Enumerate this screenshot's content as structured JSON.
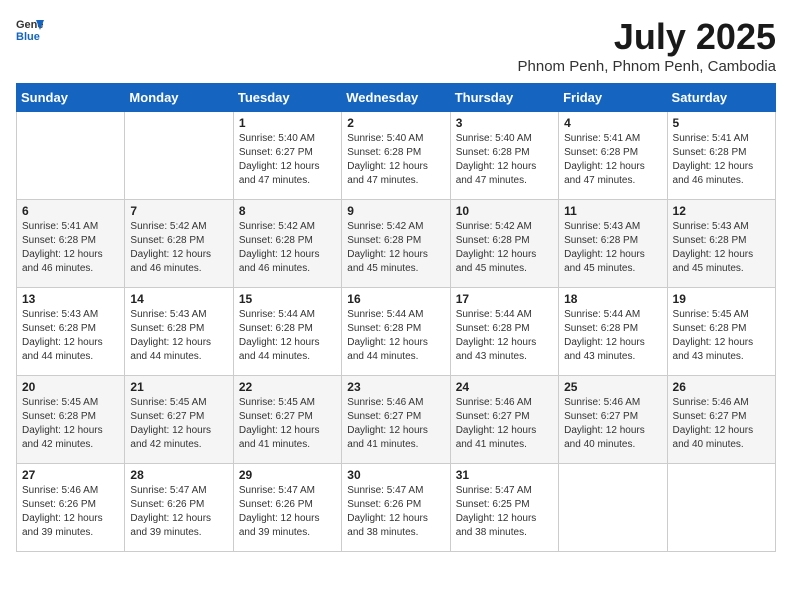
{
  "header": {
    "logo": {
      "line1": "General",
      "line2": "Blue"
    },
    "title": "July 2025",
    "subtitle": "Phnom Penh, Phnom Penh, Cambodia"
  },
  "days_of_week": [
    "Sunday",
    "Monday",
    "Tuesday",
    "Wednesday",
    "Thursday",
    "Friday",
    "Saturday"
  ],
  "weeks": [
    [
      {
        "day": "",
        "info": ""
      },
      {
        "day": "",
        "info": ""
      },
      {
        "day": "1",
        "info": "Sunrise: 5:40 AM\nSunset: 6:27 PM\nDaylight: 12 hours and 47 minutes."
      },
      {
        "day": "2",
        "info": "Sunrise: 5:40 AM\nSunset: 6:28 PM\nDaylight: 12 hours and 47 minutes."
      },
      {
        "day": "3",
        "info": "Sunrise: 5:40 AM\nSunset: 6:28 PM\nDaylight: 12 hours and 47 minutes."
      },
      {
        "day": "4",
        "info": "Sunrise: 5:41 AM\nSunset: 6:28 PM\nDaylight: 12 hours and 47 minutes."
      },
      {
        "day": "5",
        "info": "Sunrise: 5:41 AM\nSunset: 6:28 PM\nDaylight: 12 hours and 46 minutes."
      }
    ],
    [
      {
        "day": "6",
        "info": "Sunrise: 5:41 AM\nSunset: 6:28 PM\nDaylight: 12 hours and 46 minutes."
      },
      {
        "day": "7",
        "info": "Sunrise: 5:42 AM\nSunset: 6:28 PM\nDaylight: 12 hours and 46 minutes."
      },
      {
        "day": "8",
        "info": "Sunrise: 5:42 AM\nSunset: 6:28 PM\nDaylight: 12 hours and 46 minutes."
      },
      {
        "day": "9",
        "info": "Sunrise: 5:42 AM\nSunset: 6:28 PM\nDaylight: 12 hours and 45 minutes."
      },
      {
        "day": "10",
        "info": "Sunrise: 5:42 AM\nSunset: 6:28 PM\nDaylight: 12 hours and 45 minutes."
      },
      {
        "day": "11",
        "info": "Sunrise: 5:43 AM\nSunset: 6:28 PM\nDaylight: 12 hours and 45 minutes."
      },
      {
        "day": "12",
        "info": "Sunrise: 5:43 AM\nSunset: 6:28 PM\nDaylight: 12 hours and 45 minutes."
      }
    ],
    [
      {
        "day": "13",
        "info": "Sunrise: 5:43 AM\nSunset: 6:28 PM\nDaylight: 12 hours and 44 minutes."
      },
      {
        "day": "14",
        "info": "Sunrise: 5:43 AM\nSunset: 6:28 PM\nDaylight: 12 hours and 44 minutes."
      },
      {
        "day": "15",
        "info": "Sunrise: 5:44 AM\nSunset: 6:28 PM\nDaylight: 12 hours and 44 minutes."
      },
      {
        "day": "16",
        "info": "Sunrise: 5:44 AM\nSunset: 6:28 PM\nDaylight: 12 hours and 44 minutes."
      },
      {
        "day": "17",
        "info": "Sunrise: 5:44 AM\nSunset: 6:28 PM\nDaylight: 12 hours and 43 minutes."
      },
      {
        "day": "18",
        "info": "Sunrise: 5:44 AM\nSunset: 6:28 PM\nDaylight: 12 hours and 43 minutes."
      },
      {
        "day": "19",
        "info": "Sunrise: 5:45 AM\nSunset: 6:28 PM\nDaylight: 12 hours and 43 minutes."
      }
    ],
    [
      {
        "day": "20",
        "info": "Sunrise: 5:45 AM\nSunset: 6:28 PM\nDaylight: 12 hours and 42 minutes."
      },
      {
        "day": "21",
        "info": "Sunrise: 5:45 AM\nSunset: 6:27 PM\nDaylight: 12 hours and 42 minutes."
      },
      {
        "day": "22",
        "info": "Sunrise: 5:45 AM\nSunset: 6:27 PM\nDaylight: 12 hours and 41 minutes."
      },
      {
        "day": "23",
        "info": "Sunrise: 5:46 AM\nSunset: 6:27 PM\nDaylight: 12 hours and 41 minutes."
      },
      {
        "day": "24",
        "info": "Sunrise: 5:46 AM\nSunset: 6:27 PM\nDaylight: 12 hours and 41 minutes."
      },
      {
        "day": "25",
        "info": "Sunrise: 5:46 AM\nSunset: 6:27 PM\nDaylight: 12 hours and 40 minutes."
      },
      {
        "day": "26",
        "info": "Sunrise: 5:46 AM\nSunset: 6:27 PM\nDaylight: 12 hours and 40 minutes."
      }
    ],
    [
      {
        "day": "27",
        "info": "Sunrise: 5:46 AM\nSunset: 6:26 PM\nDaylight: 12 hours and 39 minutes."
      },
      {
        "day": "28",
        "info": "Sunrise: 5:47 AM\nSunset: 6:26 PM\nDaylight: 12 hours and 39 minutes."
      },
      {
        "day": "29",
        "info": "Sunrise: 5:47 AM\nSunset: 6:26 PM\nDaylight: 12 hours and 39 minutes."
      },
      {
        "day": "30",
        "info": "Sunrise: 5:47 AM\nSunset: 6:26 PM\nDaylight: 12 hours and 38 minutes."
      },
      {
        "day": "31",
        "info": "Sunrise: 5:47 AM\nSunset: 6:25 PM\nDaylight: 12 hours and 38 minutes."
      },
      {
        "day": "",
        "info": ""
      },
      {
        "day": "",
        "info": ""
      }
    ]
  ]
}
